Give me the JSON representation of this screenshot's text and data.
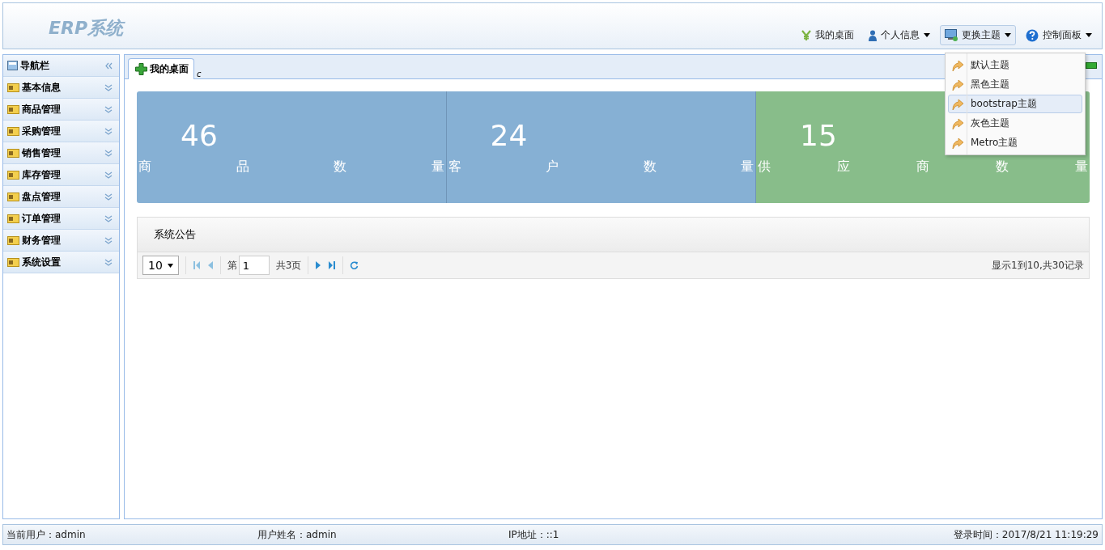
{
  "header": {
    "logo": "ERP系统",
    "links": [
      {
        "kind": "plain",
        "label": "我的桌面"
      },
      {
        "kind": "menu",
        "label": "个人信息",
        "open": false
      },
      {
        "kind": "menu",
        "label": "更换主题",
        "open": true
      },
      {
        "kind": "menu",
        "label": "控制面板",
        "open": false
      }
    ]
  },
  "theme_menu": {
    "items": [
      {
        "label": "默认主题",
        "selected": false
      },
      {
        "label": "黑色主题",
        "selected": false
      },
      {
        "label": "bootstrap主题",
        "selected": true
      },
      {
        "label": "灰色主题",
        "selected": false
      },
      {
        "label": "Metro主题",
        "selected": false
      }
    ]
  },
  "sidebar": {
    "title": "导航栏",
    "items": [
      {
        "label": "基本信息"
      },
      {
        "label": "商品管理"
      },
      {
        "label": "采购管理"
      },
      {
        "label": "销售管理"
      },
      {
        "label": "库存管理"
      },
      {
        "label": "盘点管理"
      },
      {
        "label": "订单管理"
      },
      {
        "label": "财务管理"
      },
      {
        "label": "系统设置"
      }
    ]
  },
  "tabs": [
    {
      "label": "我的桌面",
      "refresh": "c",
      "selected": true
    }
  ],
  "stats": [
    {
      "value": "46",
      "label": "商品数量",
      "color": "#86b0d4"
    },
    {
      "value": "24",
      "label": "客户数量",
      "color": "#86b0d4"
    },
    {
      "value": "15",
      "label": "供应商数量",
      "color": "#88bd8a"
    }
  ],
  "notice": {
    "title": "系统公告",
    "page_size": "10",
    "page_prefix": "第",
    "page": "1",
    "page_total": "共3页",
    "summary": "显示1到10,共30记录"
  },
  "status_bar": [
    "当前用户：admin",
    "用户姓名：admin",
    "IP地址：::1",
    "登录时间：2017/8/21 11:19:29"
  ]
}
